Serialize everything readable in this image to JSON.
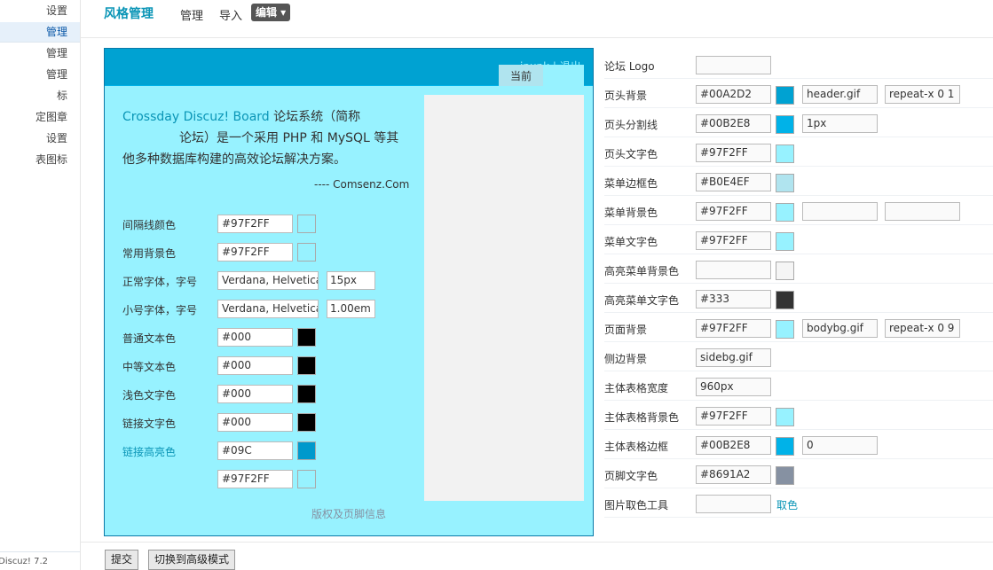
{
  "sidebar": {
    "items": [
      {
        "label": "设置",
        "active": false
      },
      {
        "label": "管理",
        "active": true
      },
      {
        "label": "管理",
        "active": false
      },
      {
        "label": "管理",
        "active": false
      },
      {
        "label": "标",
        "active": false
      },
      {
        "label": "定图章",
        "active": false
      },
      {
        "label": "设置",
        "active": false
      },
      {
        "label": "表图标",
        "active": false
      }
    ],
    "version": "Discuz! 7.2"
  },
  "nav": {
    "title": "风格管理",
    "links": [
      "管理",
      "导入"
    ],
    "dropdown": "编辑 ▾"
  },
  "preview": {
    "header_user": "ipunk | 退出",
    "current_tab": "当前",
    "intro_brand": "Crossday Discuz! Board",
    "intro_line1_rest": " 论坛系统（简称",
    "intro_line2": "论坛）是一个采用 PHP 和 MySQL 等其",
    "intro_line3": "他多种数据库构建的高效论坛解决方案。",
    "signature": "---- Comsenz.Com",
    "rows": [
      {
        "label": "间隔线颜色",
        "value": "#97F2FF",
        "swatch": "#97f2ff"
      },
      {
        "label": "常用背景色",
        "value": "#97F2FF",
        "swatch": "#97f2ff"
      },
      {
        "label": "正常字体，字号",
        "value": "Verdana, Helvetica",
        "size": "15px"
      },
      {
        "label": "小号字体，字号",
        "value": "Verdana, Helvetica",
        "size": "1.00em"
      },
      {
        "label": "普通文本色",
        "value": "#000",
        "swatch": "#000000"
      },
      {
        "label": "中等文本色",
        "value": "#000",
        "swatch": "#000000"
      },
      {
        "label": "浅色文字色",
        "value": "#000",
        "swatch": "#000000"
      },
      {
        "label": "链接文字色",
        "value": "#000",
        "swatch": "#000000"
      },
      {
        "label": "链接高亮色",
        "value": "#09C",
        "swatch": "#0099cc"
      },
      {
        "label": "",
        "value": "#97F2FF",
        "swatch": "#97f2ff"
      }
    ],
    "footer": "版权及页脚信息"
  },
  "settings": [
    {
      "label": "论坛 Logo",
      "value": ""
    },
    {
      "label": "页头背景",
      "value": "#00A2D2",
      "swatch": "#00a2d2",
      "extra1": "header.gif",
      "extra2": "repeat-x 0 1"
    },
    {
      "label": "页头分割线",
      "value": "#00B2E8",
      "swatch": "#00b2e8",
      "extra1": "1px"
    },
    {
      "label": "页头文字色",
      "value": "#97F2FF",
      "swatch": "#97f2ff"
    },
    {
      "label": "菜单边框色",
      "value": "#B0E4EF",
      "swatch": "#b0e4ef"
    },
    {
      "label": "菜单背景色",
      "value": "#97F2FF",
      "swatch": "#97f2ff",
      "extra1": "",
      "extra2": ""
    },
    {
      "label": "菜单文字色",
      "value": "#97F2FF",
      "swatch": "#97f2ff"
    },
    {
      "label": "高亮菜单背景色",
      "value": "",
      "swatch": "#f5f5f5"
    },
    {
      "label": "高亮菜单文字色",
      "value": "#333",
      "swatch": "#333333"
    },
    {
      "label": "页面背景",
      "value": "#97F2FF",
      "swatch": "#97f2ff",
      "extra1": "bodybg.gif",
      "extra2": "repeat-x 0 9"
    },
    {
      "label": "侧边背景",
      "value": "sidebg.gif"
    },
    {
      "label": "主体表格宽度",
      "value": "960px"
    },
    {
      "label": "主体表格背景色",
      "value": "#97F2FF",
      "swatch": "#97f2ff"
    },
    {
      "label": "主体表格边框",
      "value": "#00B2E8",
      "swatch": "#00b2e8",
      "extra1": "0"
    },
    {
      "label": "页脚文字色",
      "value": "#8691A2",
      "swatch": "#8691a2"
    },
    {
      "label": "图片取色工具",
      "value": "",
      "link": "取色"
    }
  ],
  "buttons": {
    "submit": "提交",
    "advanced": "切换到高级模式"
  }
}
